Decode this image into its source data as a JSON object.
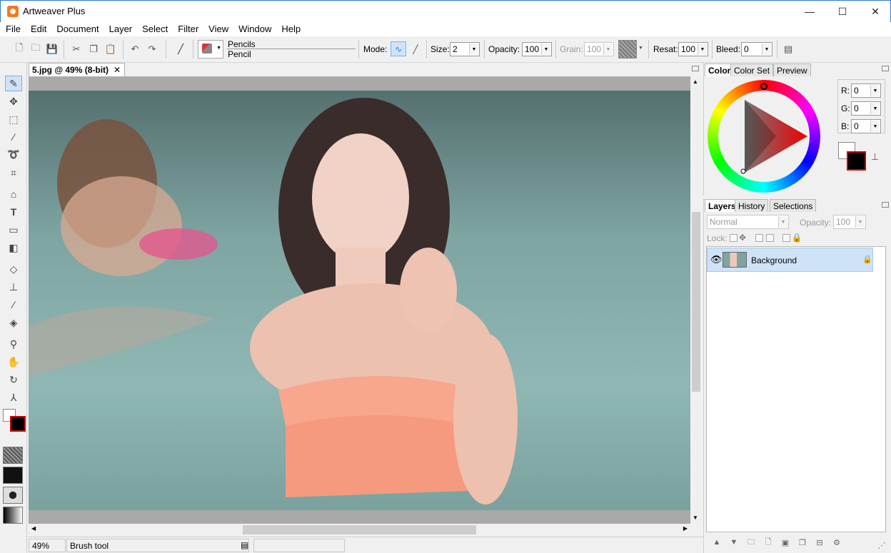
{
  "window": {
    "title": "Artweaver Plus",
    "minimize": "—",
    "maximize": "☐",
    "close": "✕"
  },
  "menu": [
    "File",
    "Edit",
    "Document",
    "Layer",
    "Select",
    "Filter",
    "View",
    "Window",
    "Help"
  ],
  "toolbar": {
    "brush_category": "Pencils",
    "brush_name": "Pencil",
    "mode_label": "Mode:",
    "size_label": "Size:",
    "size_value": "2",
    "opacity_label": "Opacity:",
    "opacity_value": "100",
    "grain_label": "Grain:",
    "grain_value": "100",
    "resat_label": "Resat:",
    "resat_value": "100",
    "bleed_label": "Bleed:",
    "bleed_value": "0"
  },
  "document": {
    "tab_title": "5.jpg @ 49% (8-bit)",
    "close": "✕"
  },
  "status": {
    "zoom": "49%",
    "tool": "Brush tool"
  },
  "color_panel": {
    "tabs": [
      "Color",
      "Color Set",
      "Preview"
    ],
    "r_label": "R:",
    "r_value": "0",
    "g_label": "G:",
    "g_value": "0",
    "b_label": "B:",
    "b_value": "0",
    "foreground": "#000000",
    "background": "#ffffff"
  },
  "layers_panel": {
    "tabs": [
      "Layers",
      "History",
      "Selections"
    ],
    "blend_mode": "Normal",
    "opacity_label": "Opacity:",
    "opacity_value": "100",
    "lock_label": "Lock:",
    "layers": [
      {
        "name": "Background",
        "visible": true,
        "locked": true
      }
    ]
  },
  "icons": [
    "pencil-icon",
    "move-icon",
    "rect-select-icon",
    "magic-wand-icon",
    "lasso-icon",
    "crop-icon",
    "perspective-icon",
    "text-icon",
    "shape-icon",
    "gradient-icon",
    "eraser-icon",
    "stamp-icon",
    "eyedropper-icon",
    "fill-icon",
    "zoom-icon",
    "hand-icon",
    "rotate-icon",
    "smudge-icon"
  ]
}
